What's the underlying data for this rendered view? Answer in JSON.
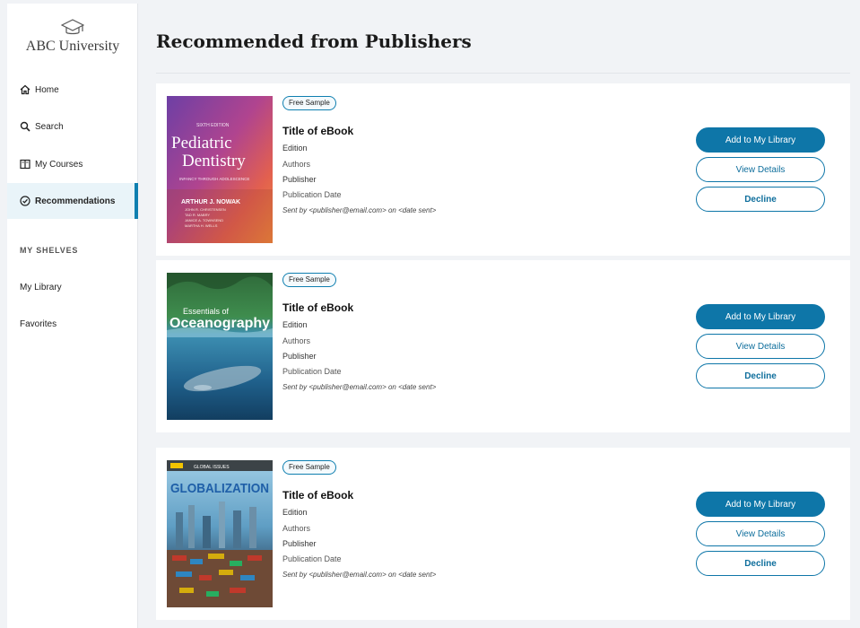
{
  "sidebar": {
    "brand": "ABC University",
    "nav": [
      {
        "label": "Home",
        "icon": "home-icon"
      },
      {
        "label": "Search",
        "icon": "search-icon"
      },
      {
        "label": "My Courses",
        "icon": "book-open-icon"
      },
      {
        "label": "Recommendations",
        "icon": "recommendation-check-icon",
        "active": true
      }
    ],
    "shelves_title": "MY SHELVES",
    "shelves": [
      "My Library",
      "Favorites"
    ]
  },
  "main": {
    "title": "Recommended from Publishers",
    "cards": [
      {
        "badge": "Free Sample",
        "title": "Title of eBook",
        "edition": "Edition",
        "authors": "Authors",
        "publisher": "Publisher",
        "pub_date": "Publication Date",
        "sent": "Sent by <publisher@email.com> on <date sent>",
        "cover": {
          "edition_line": "SIXTH EDITION",
          "title_1": "Pediatric",
          "title_2": "Dentistry",
          "subtitle": "INFANCY THROUGH ADOLESCENCE",
          "author": "ARTHUR J. NOWAK",
          "coauthors": [
            "JOHN R. CHRISTENSEN",
            "TAD R. MABRY",
            "JANICE A. TOWNSEND",
            "MARTHA H. WELLS"
          ]
        }
      },
      {
        "badge": "Free Sample",
        "title": "Title of eBook",
        "edition": "Edition",
        "authors": "Authors",
        "publisher": "Publisher",
        "pub_date": "Publication Date",
        "sent": "Sent by <publisher@email.com> on <date sent>",
        "cover": {
          "title_1": "Essentials of",
          "title_2": "Oceanography"
        }
      },
      {
        "badge": "Free Sample",
        "title": "Title of eBook",
        "edition": "Edition",
        "authors": "Authors",
        "publisher": "Publisher",
        "pub_date": "Publication Date",
        "sent": "Sent by <publisher@email.com> on <date sent>",
        "cover": {
          "series": "GLOBAL ISSUES",
          "title_1": "GLOBALIZATION"
        }
      }
    ],
    "buttons": {
      "add": "Add to My Library",
      "view": "View Details",
      "decline": "Decline"
    }
  },
  "colors": {
    "accent": "#0e76a8",
    "active_bg": "#e9f4f9",
    "page_bg": "#f1f3f6"
  }
}
